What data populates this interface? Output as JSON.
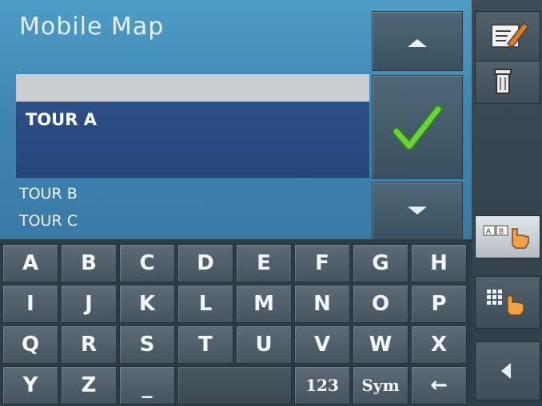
{
  "app": {
    "title": "Mobile Map"
  },
  "list": {
    "selected": "TOUR A",
    "items": [
      "TOUR B",
      "TOUR C"
    ]
  },
  "keyboard": {
    "row1": [
      "A",
      "B",
      "C",
      "D",
      "E",
      "F",
      "G",
      "H"
    ],
    "row2": [
      "I",
      "J",
      "K",
      "L",
      "M",
      "N",
      "O",
      "P"
    ],
    "row3": [
      "Q",
      "R",
      "S",
      "T",
      "U",
      "V",
      "W",
      "X"
    ],
    "row4": {
      "y": "Y",
      "z": "Z",
      "space": "_",
      "num": "123",
      "sym": "Sym",
      "back": "←"
    }
  },
  "icons": {
    "up": "triangle-up-icon",
    "ok": "checkmark-icon",
    "down": "triangle-down-icon",
    "edit": "edit-note-icon",
    "delete": "trash-icon",
    "abc": "abc-keyboard-icon",
    "grid": "grid-keyboard-icon",
    "back": "back-arrow-icon"
  },
  "colors": {
    "accent": "#3f86b3",
    "selected": "#2d4f86",
    "check": "#58b428"
  }
}
